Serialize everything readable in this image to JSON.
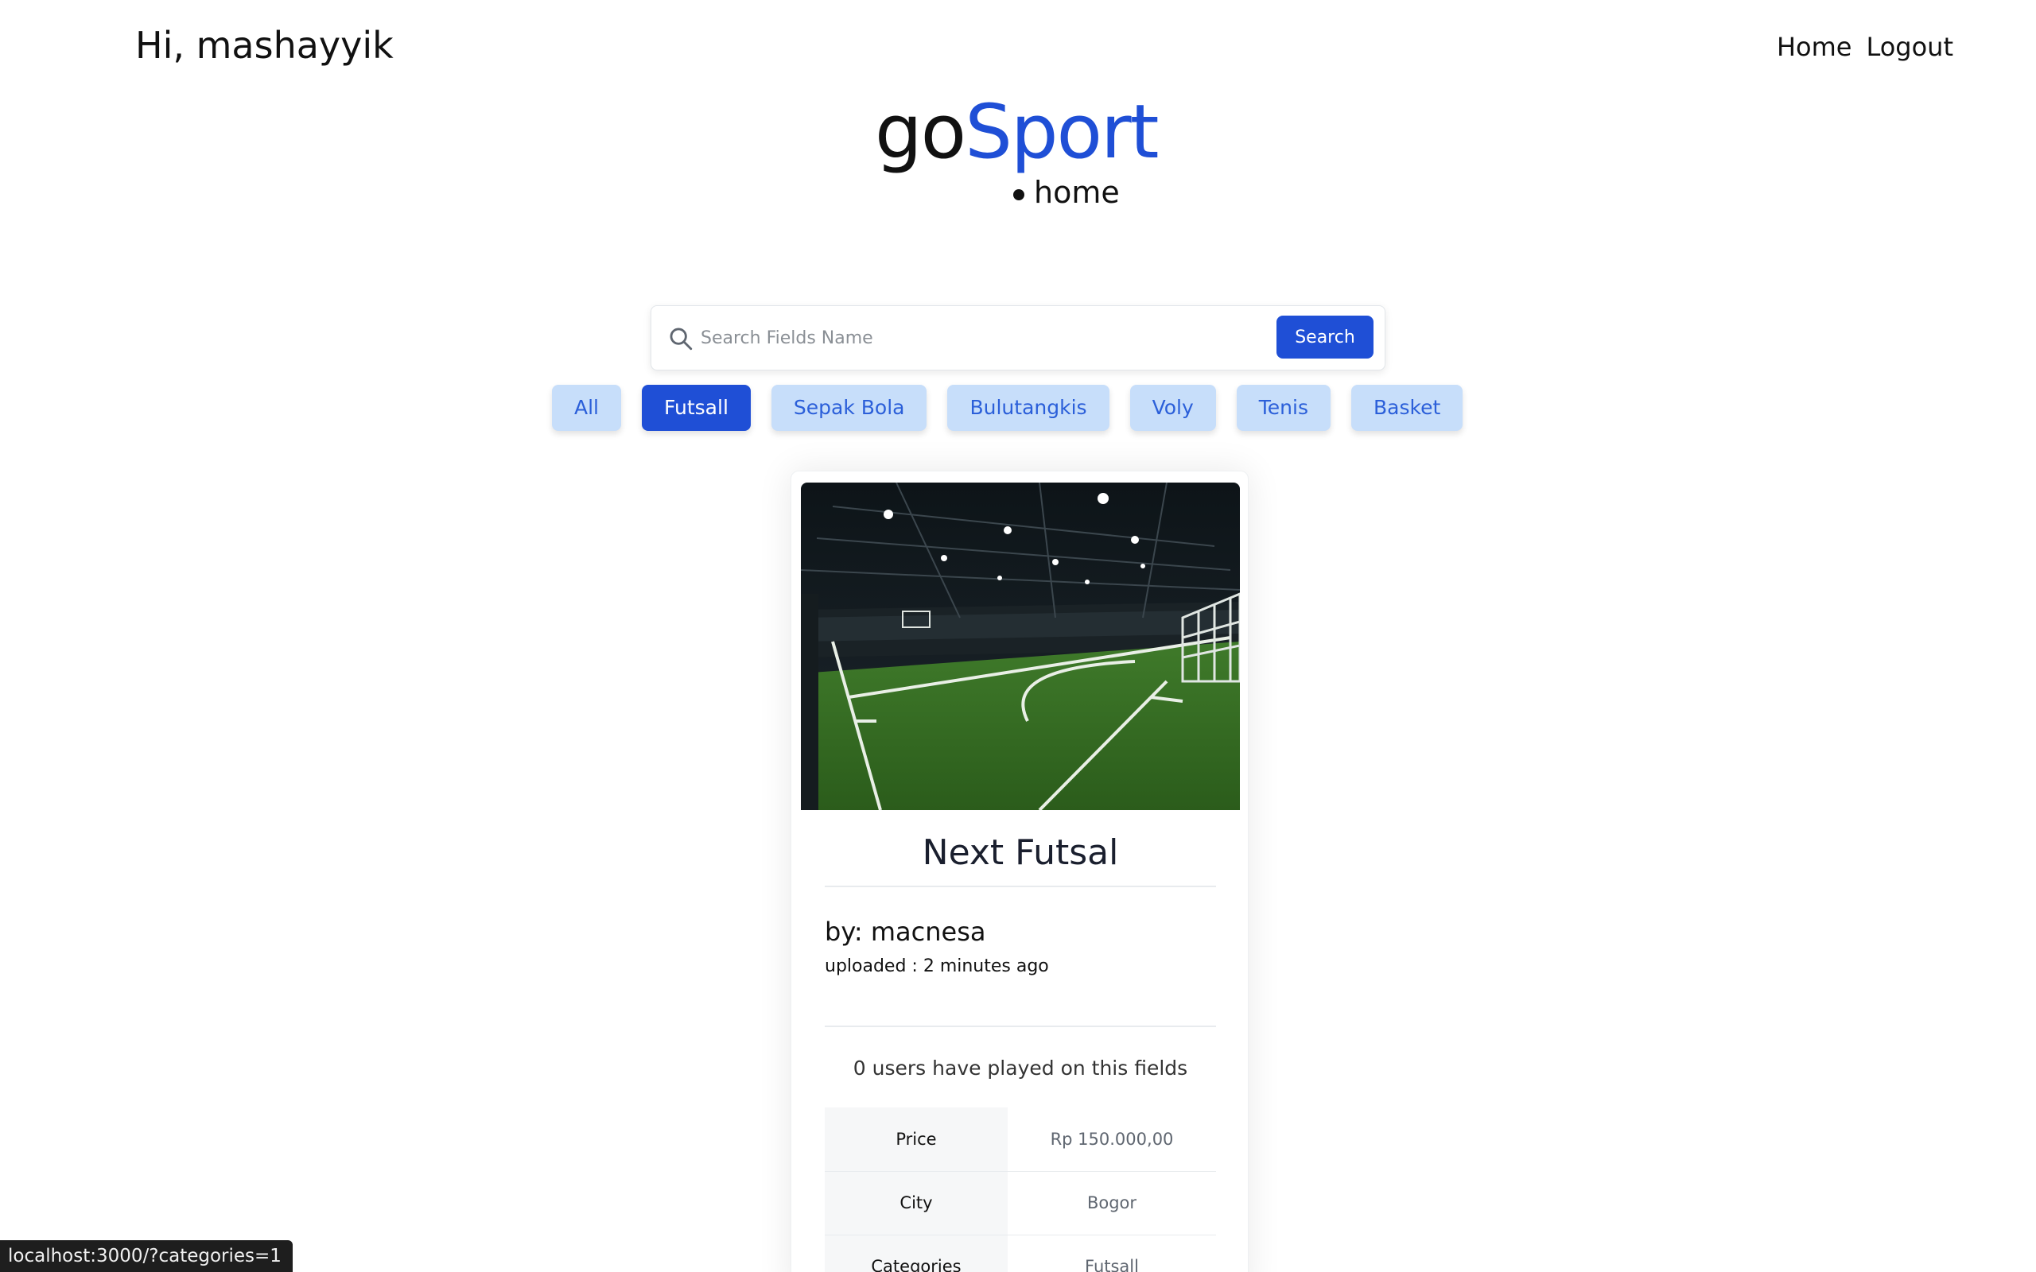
{
  "header": {
    "greeting": "Hi, mashayyik",
    "nav": [
      {
        "label": "Home"
      },
      {
        "label": "Logout"
      }
    ]
  },
  "logo": {
    "part1": "go",
    "part2": "Sport",
    "subtitle": "home"
  },
  "search": {
    "placeholder": "Search Fields Name",
    "value": "",
    "button_label": "Search"
  },
  "categories": [
    {
      "label": "All",
      "active": false
    },
    {
      "label": "Futsall",
      "active": true
    },
    {
      "label": "Sepak Bola",
      "active": false
    },
    {
      "label": "Bulutangkis",
      "active": false
    },
    {
      "label": "Voly",
      "active": false
    },
    {
      "label": "Tenis",
      "active": false
    },
    {
      "label": "Basket",
      "active": false
    }
  ],
  "field_card": {
    "image_icon": "futsal-field-photo",
    "title": "Next Futsal",
    "owner": "by: macnesa",
    "uploaded": "uploaded : 2 minutes ago",
    "played": "0 users have played on this fields",
    "details": [
      {
        "key": "Price",
        "value": "Rp 150.000,00"
      },
      {
        "key": "City",
        "value": "Bogor"
      },
      {
        "key": "Categories",
        "value": "Futsall"
      }
    ]
  },
  "status_bar": {
    "url": "localhost:3000/?categories=1"
  },
  "colors": {
    "accent": "#1f4fd6",
    "chip_bg": "#c7defa",
    "chip_text": "#2b5fd9"
  }
}
